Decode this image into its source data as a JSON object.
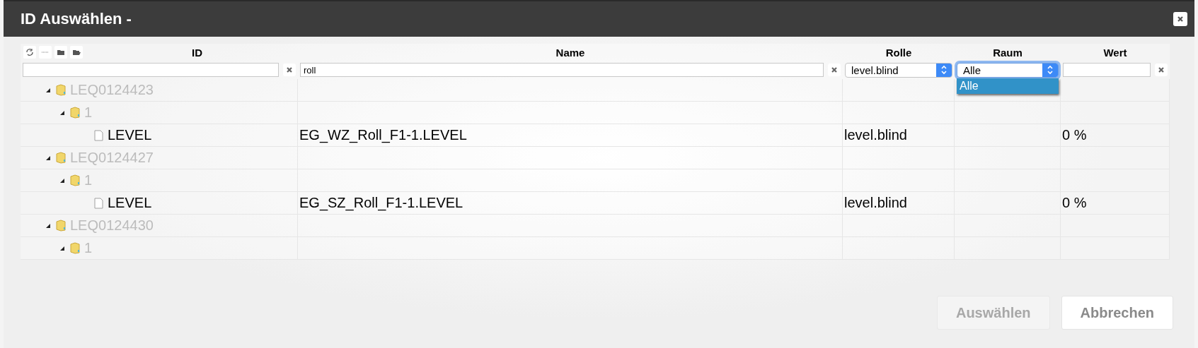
{
  "window": {
    "title": "ID Auswählen -"
  },
  "columns": [
    {
      "label": "ID"
    },
    {
      "label": "Name"
    },
    {
      "label": "Rolle"
    },
    {
      "label": "Raum"
    },
    {
      "label": "Wert"
    }
  ],
  "filters": [
    {
      "kind": "text"
    },
    {
      "kind": "text",
      "value": "roll"
    },
    {
      "kind": "select",
      "value": "level.blind",
      "focused": false
    },
    {
      "kind": "select",
      "value": "Alle",
      "focused": true,
      "options": [
        {
          "label": "Alle",
          "selected": true
        }
      ]
    },
    {
      "kind": "text"
    }
  ],
  "tree": [
    {
      "id": "LEQ0124423",
      "kind": "folder",
      "expanded": true,
      "children": [
        {
          "id": "1",
          "kind": "folder",
          "expanded": true,
          "children": [
            {
              "id": "LEVEL",
              "kind": "state",
              "name": "EG_WZ_Roll_F1-1.LEVEL",
              "role": "level.blind",
              "value": "0 %"
            }
          ]
        }
      ]
    },
    {
      "id": "LEQ0124427",
      "kind": "folder",
      "expanded": true,
      "children": [
        {
          "id": "1",
          "kind": "folder",
          "expanded": true,
          "children": [
            {
              "id": "LEVEL",
              "kind": "state",
              "name": "EG_SZ_Roll_F1-1.LEVEL",
              "role": "level.blind",
              "value": "0 %"
            }
          ]
        }
      ]
    },
    {
      "id": "LEQ0124430",
      "kind": "folder",
      "expanded": true,
      "children": [
        {
          "id": "1",
          "kind": "folder",
          "expanded": true
        }
      ]
    }
  ],
  "buttons": [
    {
      "label": "Auswählen",
      "disabled": true
    },
    {
      "label": "Abbrechen",
      "disabled": false
    }
  ]
}
